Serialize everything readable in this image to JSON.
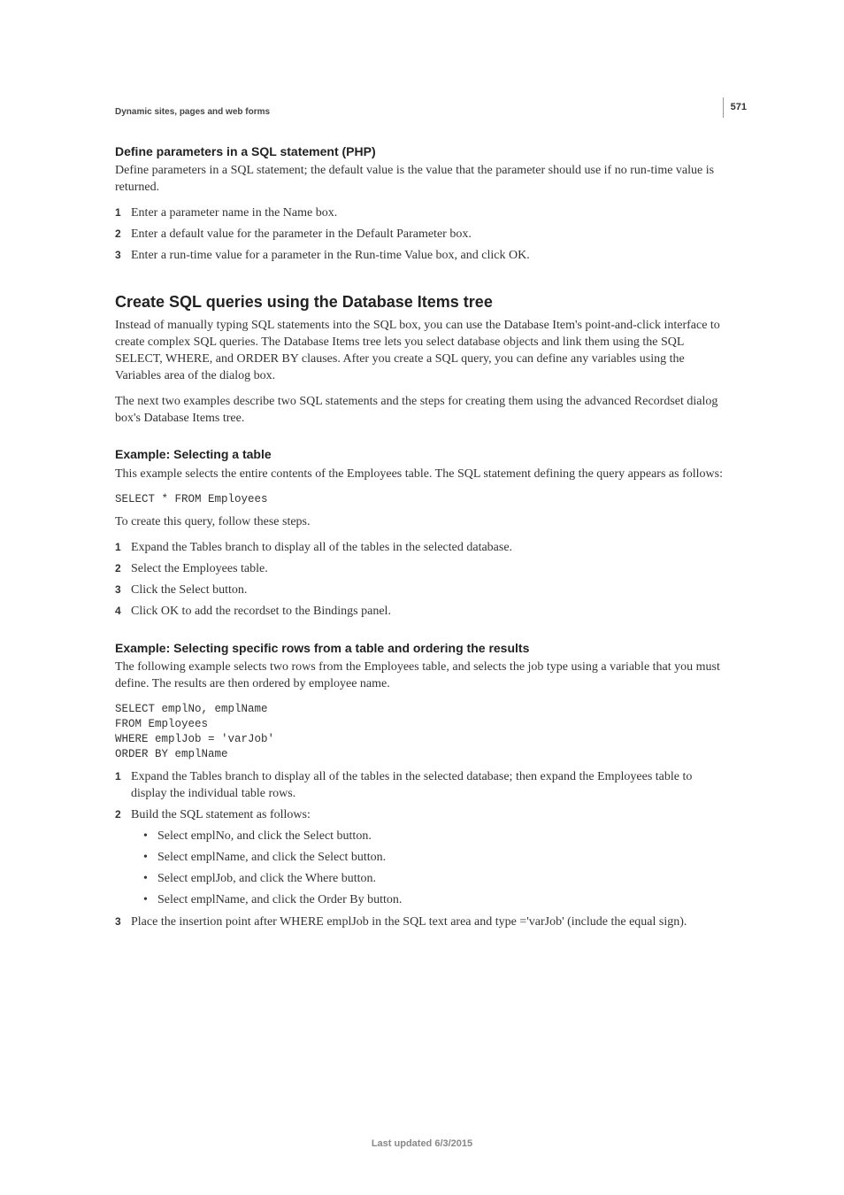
{
  "page_number": "571",
  "running_head": "Dynamic sites, pages and web forms",
  "sec1": {
    "title": "Define parameters in a SQL statement (PHP)",
    "intro": "Define parameters in a SQL statement; the default value is the value that the parameter should use if no run-time value is returned.",
    "steps": [
      "Enter a parameter name in the Name box.",
      "Enter a default value for the parameter in the Default Parameter box.",
      "Enter a run-time value for a parameter in the Run-time Value box, and click OK."
    ]
  },
  "sec2": {
    "title": "Create SQL queries using the Database Items tree",
    "para1": "Instead of manually typing SQL statements into the SQL box, you can use the Database Item's point-and-click interface to create complex SQL queries. The Database Items tree lets you select database objects and link them using the SQL SELECT, WHERE, and ORDER BY clauses. After you create a SQL query, you can define any variables using the Variables area of the dialog box.",
    "para2": "The next two examples describe two SQL statements and the steps for creating them using the advanced Recordset dialog box's Database Items tree."
  },
  "ex1": {
    "title": "Example: Selecting a table",
    "intro": "This example selects the entire contents of the Employees table. The SQL statement defining the query appears as follows:",
    "code": "SELECT * FROM Employees",
    "lead": "To create this query, follow these steps.",
    "steps": [
      "Expand the Tables branch to display all of the tables in the selected database.",
      "Select the Employees table.",
      "Click the Select button.",
      "Click OK to add the recordset to the Bindings panel."
    ]
  },
  "ex2": {
    "title": "Example: Selecting specific rows from a table and ordering the results",
    "intro": "The following example selects two rows from the Employees table, and selects the job type using a variable that you must define. The results are then ordered by employee name.",
    "code": "SELECT emplNo, emplName\nFROM Employees\nWHERE emplJob = 'varJob'\nORDER BY emplName",
    "steps": [
      "Expand the Tables branch to display all of the tables in the selected database; then expand the Employees table to display the individual table rows.",
      "Build the SQL statement as follows:",
      "Place the insertion point after WHERE emplJob in the SQL text area and type ='varJob' (include the equal sign)."
    ],
    "bullets": [
      "Select emplNo, and click the Select button.",
      "Select emplName, and click the Select button.",
      "Select emplJob, and click the Where button.",
      "Select emplName, and click the Order By button."
    ]
  },
  "footer": "Last updated 6/3/2015"
}
